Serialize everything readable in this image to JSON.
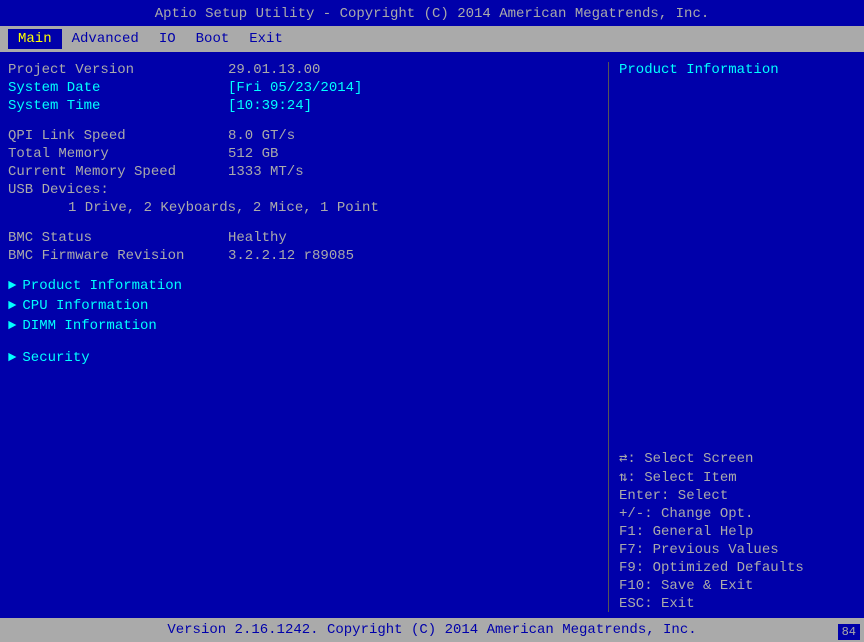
{
  "title_bar": {
    "text": "Aptio Setup Utility - Copyright (C) 2014 American Megatrends, Inc."
  },
  "menu": {
    "items": [
      {
        "label": "Main",
        "active": true
      },
      {
        "label": "Advanced",
        "active": false
      },
      {
        "label": "IO",
        "active": false
      },
      {
        "label": "Boot",
        "active": false
      },
      {
        "label": "Exit",
        "active": false
      }
    ]
  },
  "main": {
    "system_info": [
      {
        "label": "Project Version",
        "value": "29.01.13.00",
        "highlight": false
      },
      {
        "label": "System Date",
        "value": "[Fri 05/23/2014]",
        "highlight": true
      },
      {
        "label": "System Time",
        "value": "[10:39:24]",
        "highlight": true
      }
    ],
    "hardware_info": [
      {
        "label": "QPI Link Speed",
        "value": "8.0 GT/s",
        "highlight": false
      },
      {
        "label": "Total Memory",
        "value": "512 GB",
        "highlight": false
      },
      {
        "label": "Current Memory Speed",
        "value": "1333 MT/s",
        "highlight": false
      },
      {
        "label": "USB Devices:",
        "value": "",
        "highlight": false
      }
    ],
    "usb_devices": "1 Drive, 2 Keyboards, 2 Mice, 1 Point",
    "bmc_info": [
      {
        "label": "BMC Status",
        "value": "Healthy",
        "highlight": false
      },
      {
        "label": "BMC Firmware Revision",
        "value": "3.2.2.12 r89085",
        "highlight": false
      }
    ],
    "nav_items": [
      {
        "label": "Product Information"
      },
      {
        "label": "CPU Information"
      },
      {
        "label": "DIMM Information"
      }
    ],
    "nav_items2": [
      {
        "label": "Security"
      }
    ]
  },
  "right_panel": {
    "title": "Product Information",
    "help": [
      {
        "key": "↔:",
        "desc": "Select Screen"
      },
      {
        "key": "↕:",
        "desc": "Select Item"
      },
      {
        "key": "Enter:",
        "desc": "Select"
      },
      {
        "key": "+/-:",
        "desc": "Change Opt."
      },
      {
        "key": "F1:",
        "desc": "General Help"
      },
      {
        "key": "F7:",
        "desc": "Previous Values"
      },
      {
        "key": "F9:",
        "desc": "Optimized Defaults"
      },
      {
        "key": "F10:",
        "desc": "Save & Exit"
      },
      {
        "key": "ESC:",
        "desc": "Exit"
      }
    ]
  },
  "footer": {
    "text": "Version 2.16.1242. Copyright (C) 2014 American Megatrends, Inc.",
    "badge": "84"
  }
}
